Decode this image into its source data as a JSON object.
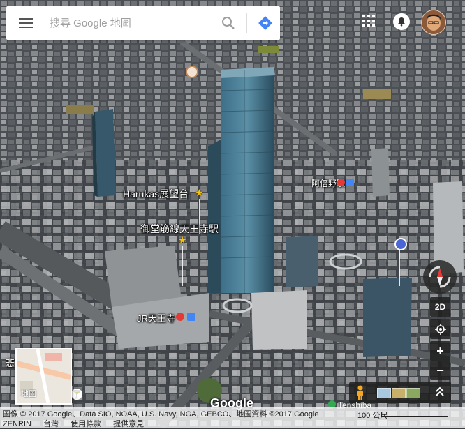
{
  "search": {
    "placeholder": "搜尋 Google 地圖"
  },
  "labels": {
    "harukas": "Harukas展望台",
    "midosuji": "御堂筋線天王寺駅",
    "abenobashi": "阿倍野駅",
    "jr_tennoji": "JR天王寺",
    "tennoji_left": "悲",
    "street": "Tenshiba"
  },
  "controls": {
    "mode_2d": "2D",
    "zoom_in": "+",
    "zoom_out": "−"
  },
  "minimap": {
    "label": "地圖"
  },
  "footer": {
    "attribution": "圖像 © 2017 Google、Data SIO, NOAA, U.S. Navy, NGA, GEBCO、地圖資料 ©2017 Google",
    "zenrin": "ZENRIN",
    "region": "台灣",
    "terms": "使用條款",
    "feedback": "提供意見",
    "scale": "100 公尺"
  },
  "logo": "Google",
  "colors": {
    "accent_blue": "#4285f4",
    "rail_red": "#e53935"
  }
}
